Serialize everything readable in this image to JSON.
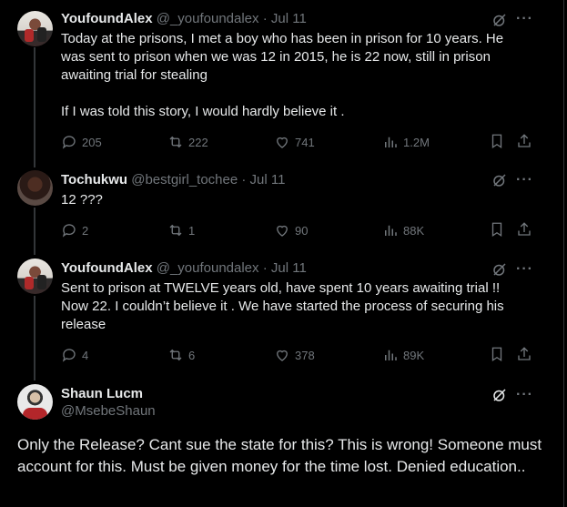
{
  "replies": [
    {
      "name": "YoufoundAlex",
      "handle": "@_youfoundalex",
      "dot": "·",
      "date": "Jul 11",
      "text": "Today at the prisons, I met a boy who has been in prison for 10 years. He was sent to prison when we was 12 in 2015, he is 22 now, still in prison awaiting trial for stealing\n\nIf I was told this story, I would hardly believe it .",
      "replies": "205",
      "reposts": "222",
      "likes": "741",
      "views": "1.2M"
    },
    {
      "name": "Tochukwu",
      "handle": "@bestgirl_tochee",
      "dot": "·",
      "date": "Jul 11",
      "text": "12 ???",
      "replies": "2",
      "reposts": "1",
      "likes": "90",
      "views": "88K"
    },
    {
      "name": "YoufoundAlex",
      "handle": "@_youfoundalex",
      "dot": "·",
      "date": "Jul 11",
      "text": "Sent to prison at TWELVE years old, have spent 10 years awaiting trial !! Now 22. I couldn’t believe it . We have started the process of securing his release",
      "replies": "4",
      "reposts": "6",
      "likes": "378",
      "views": "89K"
    }
  ],
  "main_tweet": {
    "name": "Shaun Lucm",
    "handle": "@MsebeShaun",
    "text": "Only the Release? Cant sue the state for this? This is wrong! Someone must account for this. Must be given money for the time lost. Denied education.."
  },
  "icons": {
    "grok": "grok-icon",
    "more": "more-icon",
    "reply": "reply-icon",
    "repost": "repost-icon",
    "like": "like-icon",
    "views": "views-icon",
    "bookmark": "bookmark-icon",
    "share": "share-icon"
  },
  "colors": {
    "background": "#000000",
    "text": "#e7e9ea",
    "secondary": "#71767b",
    "thread_line": "#333639"
  }
}
